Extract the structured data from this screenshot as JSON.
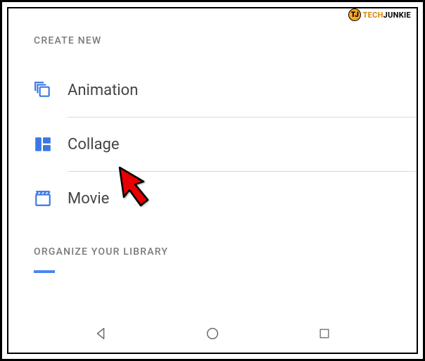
{
  "watermark": {
    "badge_letter": "TJ",
    "text1": "TECH",
    "text2": "JUNKIE"
  },
  "sections": {
    "create_new": {
      "header": "CREATE NEW",
      "items": [
        {
          "label": "Animation",
          "icon": "animation-icon"
        },
        {
          "label": "Collage",
          "icon": "collage-icon"
        },
        {
          "label": "Movie",
          "icon": "movie-icon"
        }
      ]
    },
    "organize": {
      "header": "ORGANIZE YOUR LIBRARY"
    }
  },
  "colors": {
    "accent": "#3b78e7",
    "icon_blue": "#3b78e7",
    "text_gray": "#444",
    "header_gray": "#7a7a7a",
    "divider": "#d8d8d8",
    "arrow_red": "#e60000"
  },
  "pointer": {
    "target": "Collage"
  },
  "nav": {
    "buttons": [
      "back",
      "home",
      "recent"
    ]
  }
}
